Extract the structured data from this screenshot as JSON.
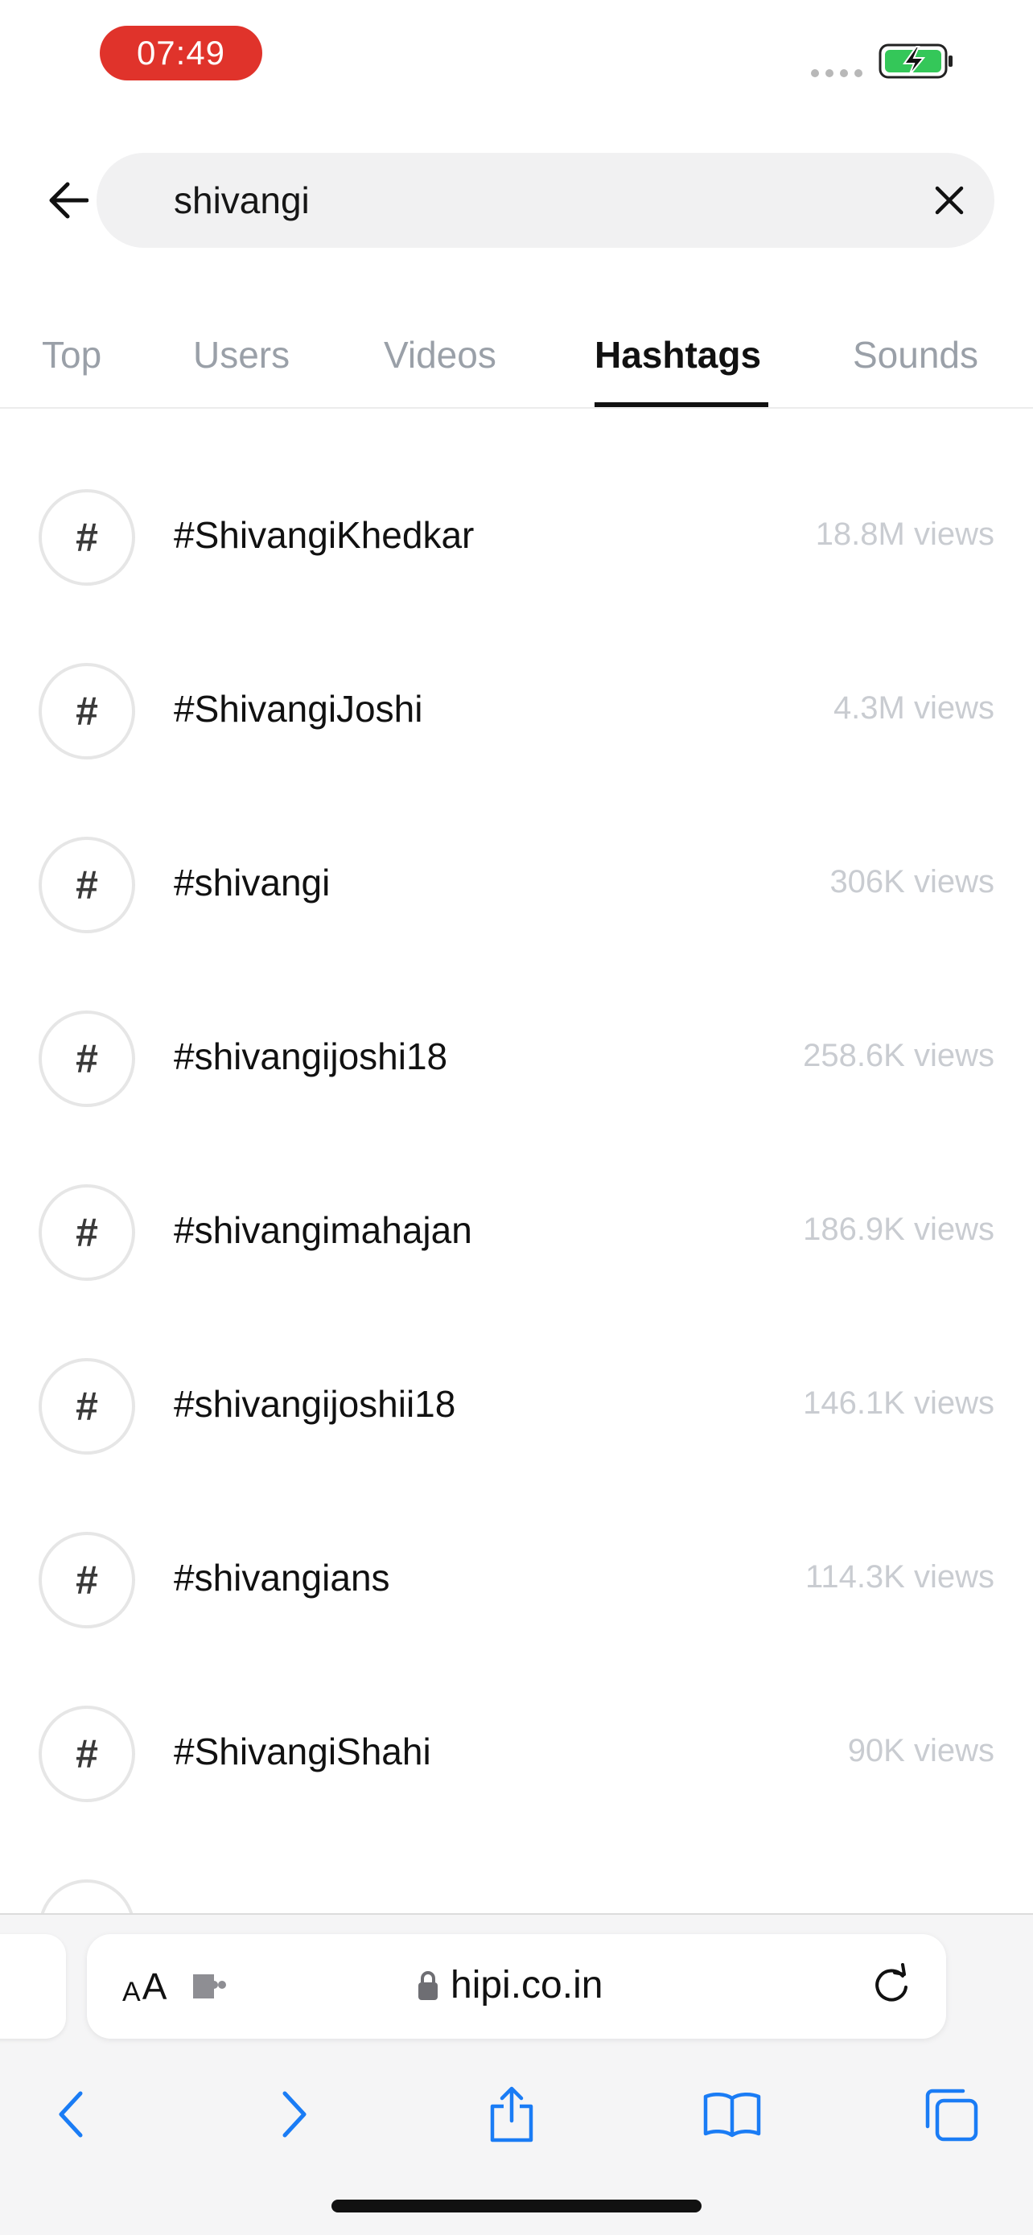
{
  "status_bar": {
    "time": "07:49"
  },
  "search": {
    "value": "shivangi"
  },
  "tabs": [
    {
      "label": "Top",
      "active": false
    },
    {
      "label": "Users",
      "active": false
    },
    {
      "label": "Videos",
      "active": false
    },
    {
      "label": "Hashtags",
      "active": true
    },
    {
      "label": "Sounds",
      "active": false
    }
  ],
  "hashtags": [
    {
      "tag": "#ShivangiKhedkar",
      "views": "18.8M views"
    },
    {
      "tag": "#ShivangiJoshi",
      "views": "4.3M views"
    },
    {
      "tag": "#shivangi",
      "views": "306K views"
    },
    {
      "tag": "#shivangijoshi18",
      "views": "258.6K views"
    },
    {
      "tag": "#shivangimahajan",
      "views": "186.9K views"
    },
    {
      "tag": "#shivangijoshii18",
      "views": "146.1K views"
    },
    {
      "tag": "#shivangians",
      "views": "114.3K views"
    },
    {
      "tag": "#ShivangiShahi",
      "views": "90K views"
    }
  ],
  "hash_symbol": "#",
  "browser": {
    "text_size_label_small": "A",
    "text_size_label_large": "A",
    "url": "hipi.co.in"
  },
  "icons": {
    "back": "arrow-left-icon",
    "clear": "close-icon",
    "lock": "lock-icon",
    "reload": "reload-icon",
    "nav_back": "chevron-left-icon",
    "nav_forward": "chevron-right-icon",
    "share": "share-icon",
    "bookmarks": "book-icon",
    "tabs": "tabs-icon"
  },
  "colors": {
    "time_pill": "#e0332b",
    "active_tab": "#111111",
    "inactive_tab": "#9aa0a8",
    "views_text": "#c9ccd1",
    "safari_blue": "#1a7cf5",
    "battery_green": "#34c759"
  }
}
